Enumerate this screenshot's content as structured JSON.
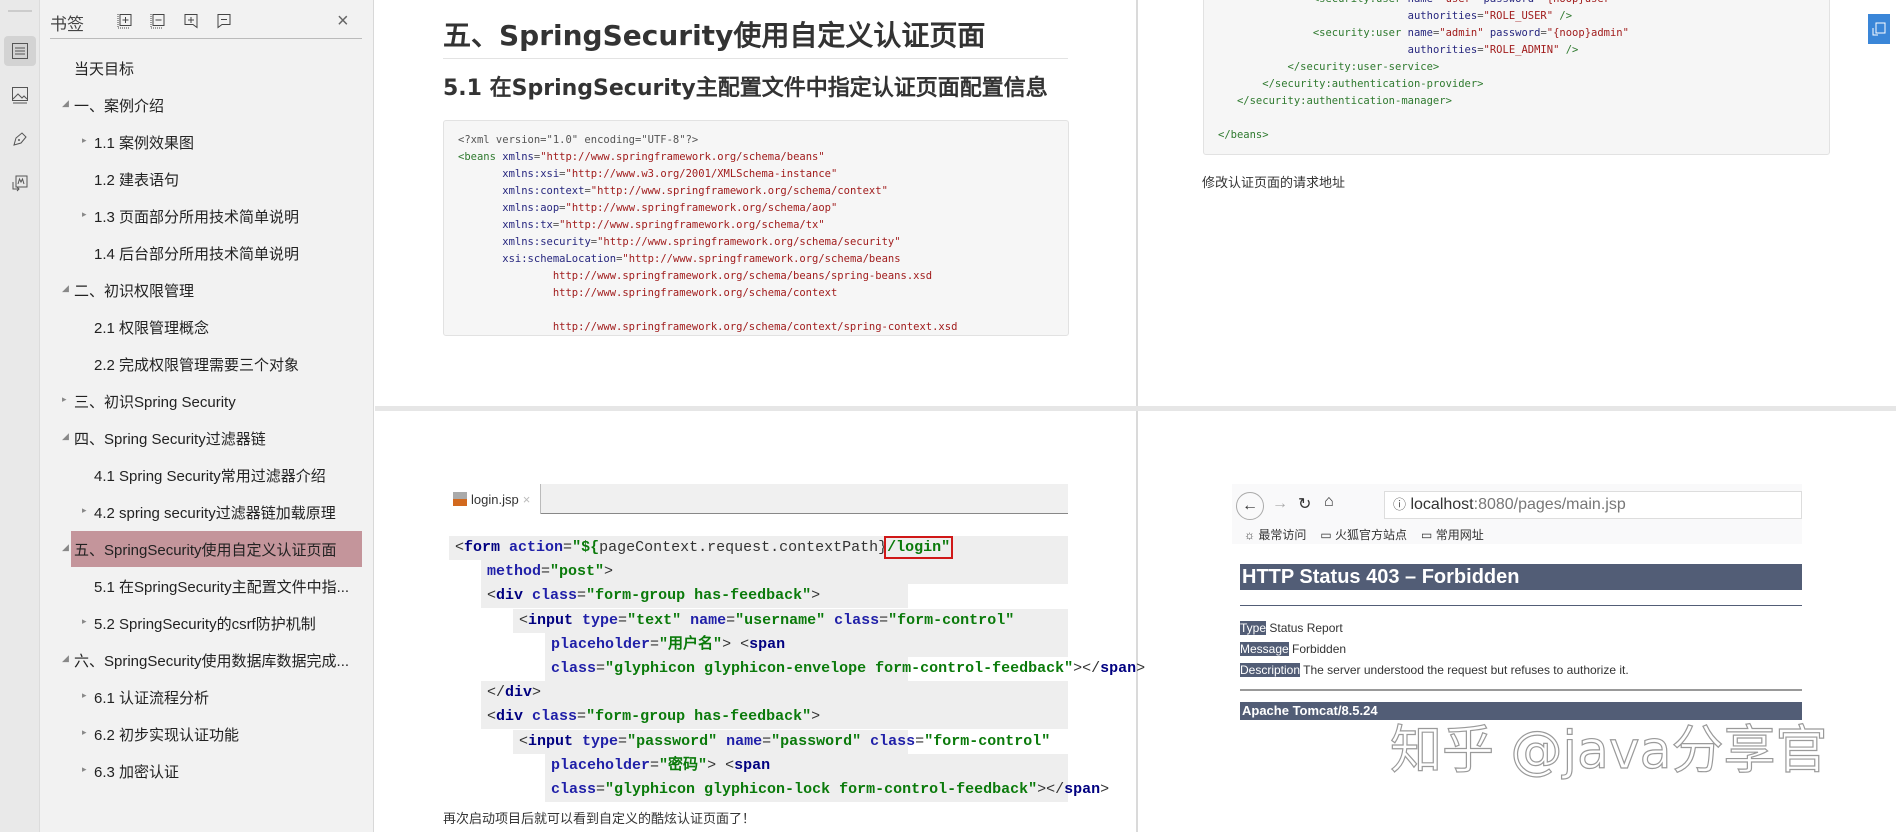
{
  "sidebar": {
    "title": "书签",
    "close_icon": "×",
    "rail_icons": [
      "bookmark-list-icon",
      "image-icon",
      "pen-icon",
      "convert-icon"
    ],
    "items": [
      {
        "label": "当天目标",
        "level": 1,
        "arrow": ""
      },
      {
        "label": "一、案例介绍",
        "level": 1,
        "arrow": "◢"
      },
      {
        "label": "1.1 案例效果图",
        "level": 2,
        "arrow": "▸"
      },
      {
        "label": "1.2 建表语句",
        "level": 2,
        "arrow": ""
      },
      {
        "label": "1.3 页面部分所用技术简单说明",
        "level": 2,
        "arrow": "▸"
      },
      {
        "label": "1.4 后台部分所用技术简单说明",
        "level": 2,
        "arrow": ""
      },
      {
        "label": "二、初识权限管理",
        "level": 1,
        "arrow": "◢"
      },
      {
        "label": "2.1 权限管理概念",
        "level": 2,
        "arrow": ""
      },
      {
        "label": "2.2 完成权限管理需要三个对象",
        "level": 2,
        "arrow": ""
      },
      {
        "label": "三、初识Spring Security",
        "level": 1,
        "arrow": "▸"
      },
      {
        "label": "四、Spring Security过滤器链",
        "level": 1,
        "arrow": "◢"
      },
      {
        "label": "4.1 Spring Security常用过滤器介绍",
        "level": 2,
        "arrow": ""
      },
      {
        "label": "4.2 spring security过滤器链加载原理",
        "level": 2,
        "arrow": "▸"
      },
      {
        "label": "五、SpringSecurity使用自定义认证页面",
        "level": 1,
        "arrow": "◢",
        "selected": true
      },
      {
        "label": "5.1 在SpringSecurity主配置文件中指...",
        "level": 2,
        "arrow": ""
      },
      {
        "label": "5.2 SpringSecurity的csrf防护机制",
        "level": 2,
        "arrow": "▸"
      },
      {
        "label": "六、SpringSecurity使用数据库数据完成...",
        "level": 1,
        "arrow": "◢"
      },
      {
        "label": "6.1 认证流程分析",
        "level": 2,
        "arrow": "▸"
      },
      {
        "label": "6.2 初步实现认证功能",
        "level": 2,
        "arrow": "▸"
      },
      {
        "label": "6.3 加密认证",
        "level": 2,
        "arrow": "▸"
      }
    ]
  },
  "page1": {
    "heading": "五、SpringSecurity使用自定义认证页面",
    "subheading": "5.1 在SpringSecurity主配置文件中指定认证页面配置信息",
    "code": [
      [
        [
          "p",
          "<?xml version=\"1.0\" encoding=\"UTF-8\"?>"
        ]
      ],
      [
        [
          "t",
          "<beans "
        ],
        [
          "a",
          "xmlns"
        ],
        [
          "p",
          "="
        ],
        [
          "v",
          "\"http://www.springframework.org/schema/beans\""
        ]
      ],
      [
        [
          "p",
          "       "
        ],
        [
          "a",
          "xmlns:xsi"
        ],
        [
          "p",
          "="
        ],
        [
          "v",
          "\"http://www.w3.org/2001/XMLSchema-instance\""
        ]
      ],
      [
        [
          "p",
          "       "
        ],
        [
          "a",
          "xmlns:context"
        ],
        [
          "p",
          "="
        ],
        [
          "v",
          "\"http://www.springframework.org/schema/context\""
        ]
      ],
      [
        [
          "p",
          "       "
        ],
        [
          "a",
          "xmlns:aop"
        ],
        [
          "p",
          "="
        ],
        [
          "v",
          "\"http://www.springframework.org/schema/aop\""
        ]
      ],
      [
        [
          "p",
          "       "
        ],
        [
          "a",
          "xmlns:tx"
        ],
        [
          "p",
          "="
        ],
        [
          "v",
          "\"http://www.springframework.org/schema/tx\""
        ]
      ],
      [
        [
          "p",
          "       "
        ],
        [
          "a",
          "xmlns:security"
        ],
        [
          "p",
          "="
        ],
        [
          "v",
          "\"http://www.springframework.org/schema/security\""
        ]
      ],
      [
        [
          "p",
          "       "
        ],
        [
          "a",
          "xsi:schemaLocation"
        ],
        [
          "p",
          "="
        ],
        [
          "v",
          "\"http://www.springframework.org/schema/beans"
        ]
      ],
      [
        [
          "v",
          "               http://www.springframework.org/schema/beans/spring-beans.xsd"
        ]
      ],
      [
        [
          "v",
          "               http://www.springframework.org/schema/context"
        ]
      ],
      [
        [
          "p",
          " "
        ]
      ],
      [
        [
          "v",
          "               http://www.springframework.org/schema/context/spring-context.xsd"
        ]
      ]
    ]
  },
  "page2": {
    "code": [
      [
        [
          "p",
          "               "
        ],
        [
          "t",
          "<security:user "
        ],
        [
          "a",
          "name"
        ],
        [
          "p",
          "="
        ],
        [
          "v",
          "\"user\" "
        ],
        [
          "a",
          "password"
        ],
        [
          "p",
          "="
        ],
        [
          "v",
          "\"{noop}user\""
        ]
      ],
      [
        [
          "p",
          "                              "
        ],
        [
          "a",
          "authorities"
        ],
        [
          "p",
          "="
        ],
        [
          "v",
          "\"ROLE_USER\""
        ],
        [
          "t",
          " />"
        ]
      ],
      [
        [
          "p",
          "               "
        ],
        [
          "t",
          "<security:user "
        ],
        [
          "a",
          "name"
        ],
        [
          "p",
          "="
        ],
        [
          "v",
          "\"admin\" "
        ],
        [
          "a",
          "password"
        ],
        [
          "p",
          "="
        ],
        [
          "v",
          "\"{noop}admin\""
        ]
      ],
      [
        [
          "p",
          "                              "
        ],
        [
          "a",
          "authorities"
        ],
        [
          "p",
          "="
        ],
        [
          "v",
          "\"ROLE_ADMIN\""
        ],
        [
          "t",
          " />"
        ]
      ],
      [
        [
          "t",
          "           </security:user-service>"
        ]
      ],
      [
        [
          "t",
          "       </security:authentication-provider>"
        ]
      ],
      [
        [
          "t",
          "   </security:authentication-manager>"
        ]
      ],
      [
        [
          "p",
          " "
        ]
      ],
      [
        [
          "t",
          "</beans>"
        ]
      ]
    ],
    "caption": "修改认证页面的请求地址"
  },
  "page3": {
    "tab_label": "login.jsp",
    "tab_close": "×",
    "lines": [
      {
        "indent": 0,
        "seg": [
          [
            "pl",
            "<"
          ],
          [
            "k",
            "form "
          ],
          [
            "an",
            "action"
          ],
          [
            "pl",
            "="
          ],
          [
            "av",
            "\"${"
          ],
          [
            "pl",
            "pageContext.request.contextPath}"
          ],
          [
            "av",
            "/login\"",
            "box"
          ]
        ]
      },
      {
        "indent": 2,
        "seg": [
          [
            "an",
            "method"
          ],
          [
            "pl",
            "="
          ],
          [
            "av",
            "\"post\""
          ],
          [
            "pl",
            ">"
          ]
        ]
      },
      {
        "indent": 2,
        "seg": [
          [
            "pl",
            "<"
          ],
          [
            "k",
            "div "
          ],
          [
            "an",
            "class"
          ],
          [
            "pl",
            "="
          ],
          [
            "av",
            "\"form-group has-feedback\""
          ],
          [
            "pl",
            ">"
          ]
        ]
      },
      {
        "indent": 4,
        "seg": [
          [
            "pl",
            "<"
          ],
          [
            "k",
            "input "
          ],
          [
            "an",
            "type"
          ],
          [
            "pl",
            "="
          ],
          [
            "av",
            "\"text\" "
          ],
          [
            "an",
            "name"
          ],
          [
            "pl",
            "="
          ],
          [
            "av",
            "\"username\" "
          ],
          [
            "an",
            "class"
          ],
          [
            "pl",
            "="
          ],
          [
            "av",
            "\"form-control\""
          ]
        ]
      },
      {
        "indent": 6,
        "seg": [
          [
            "an",
            "placeholder"
          ],
          [
            "pl",
            "="
          ],
          [
            "av",
            "\"用户名\""
          ],
          [
            "pl",
            "> <"
          ],
          [
            "k",
            "span"
          ]
        ]
      },
      {
        "indent": 6,
        "seg": [
          [
            "an",
            "class"
          ],
          [
            "pl",
            "="
          ],
          [
            "av",
            "\"glyphicon glyphicon-envelope form-control-feedback\""
          ],
          [
            "pl",
            "></"
          ],
          [
            "k",
            "span"
          ],
          [
            "pl",
            ">"
          ]
        ]
      },
      {
        "indent": 2,
        "seg": [
          [
            "pl",
            "</"
          ],
          [
            "k",
            "div"
          ],
          [
            "pl",
            ">"
          ]
        ]
      },
      {
        "indent": 2,
        "seg": [
          [
            "pl",
            "<"
          ],
          [
            "k",
            "div "
          ],
          [
            "an",
            "class"
          ],
          [
            "pl",
            "="
          ],
          [
            "av",
            "\"form-group has-feedback\""
          ],
          [
            "pl",
            ">"
          ]
        ]
      },
      {
        "indent": 4,
        "seg": [
          [
            "pl",
            "<"
          ],
          [
            "k",
            "input "
          ],
          [
            "an",
            "type"
          ],
          [
            "pl",
            "="
          ],
          [
            "av",
            "\"password\" "
          ],
          [
            "an",
            "name"
          ],
          [
            "pl",
            "="
          ],
          [
            "av",
            "\"password\" "
          ],
          [
            "an",
            "class"
          ],
          [
            "pl",
            "="
          ],
          [
            "av",
            "\"form-control\""
          ]
        ]
      },
      {
        "indent": 6,
        "seg": [
          [
            "an",
            "placeholder"
          ],
          [
            "pl",
            "="
          ],
          [
            "av",
            "\"密码\""
          ],
          [
            "pl",
            "> <"
          ],
          [
            "k",
            "span"
          ]
        ]
      },
      {
        "indent": 6,
        "seg": [
          [
            "an",
            "class"
          ],
          [
            "pl",
            "="
          ],
          [
            "av",
            "\"glyphicon glyphicon-lock form-control-feedback\""
          ],
          [
            "pl",
            "></"
          ],
          [
            "k",
            "span"
          ],
          [
            "pl",
            ">"
          ]
        ]
      }
    ],
    "caption": "再次启动项目后就可以看到自定义的酷炫认证页面了！"
  },
  "page4": {
    "url_host": "localhost",
    "url_rest": ":8080/pages/main.jsp",
    "bookmarks": [
      "最常访问",
      "火狐官方站点",
      "常用网址"
    ],
    "title": "HTTP Status 403 – Forbidden",
    "rows": [
      {
        "label": "Type",
        "value": "Status Report"
      },
      {
        "label": "Message",
        "value": "Forbidden"
      },
      {
        "label": "Description",
        "value": "The server understood the request but refuses to authorize it."
      }
    ],
    "footer": "Apache Tomcat/8.5.24"
  },
  "watermark": "知乎 @java分享官",
  "colors": {
    "selected": "#c4959b",
    "tomcat": "#525d76",
    "accent": "#3a86d8"
  }
}
